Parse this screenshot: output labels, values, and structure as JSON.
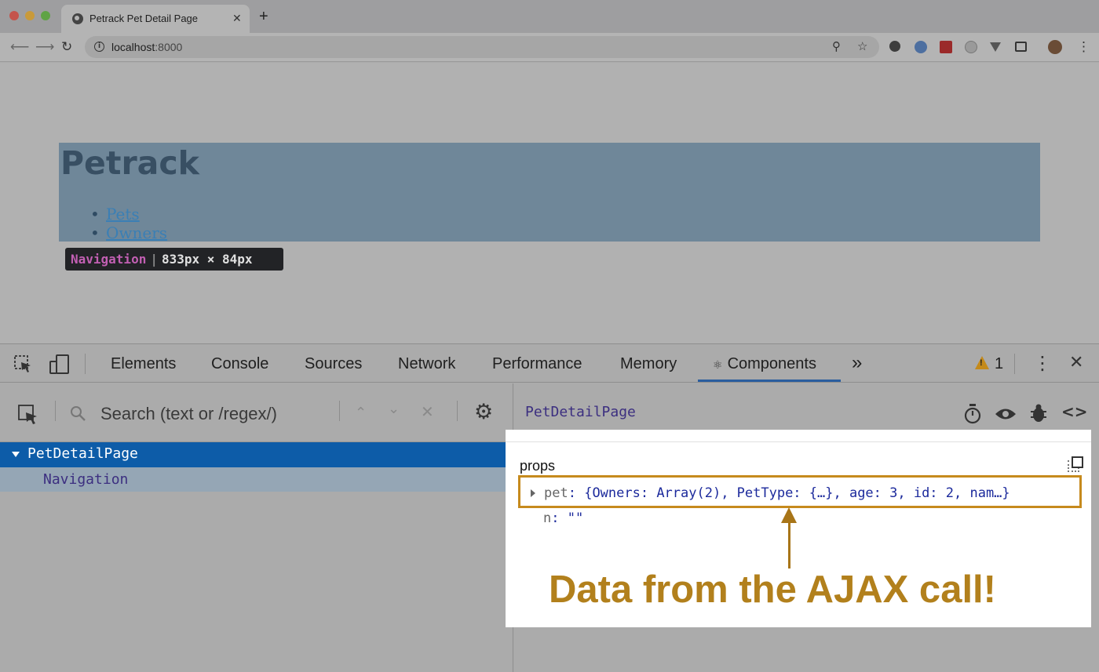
{
  "browser": {
    "tab_title": "Petrack Pet Detail Page",
    "tab_close": "✕",
    "new_tab": "+",
    "url_host": "localhost",
    "url_port": ":8000"
  },
  "page": {
    "site_title": "Petrack",
    "nav_links": [
      "Pets",
      "Owners"
    ],
    "inspect_tooltip": {
      "component": "Navigation",
      "separator": "|",
      "size": "833px × 84px"
    }
  },
  "devtools": {
    "tabs": [
      "Elements",
      "Console",
      "Sources",
      "Network",
      "Performance",
      "Memory",
      "Components"
    ],
    "active_tab": "Components",
    "more_tabs": "»",
    "warning_count": "1",
    "close": "✕",
    "search_placeholder": "Search (text or /regex/)",
    "tree": [
      {
        "label": "PetDetailPage",
        "selected": true
      },
      {
        "label": "Navigation",
        "selected": false
      }
    ],
    "selected_component": "PetDetailPage",
    "props_title": "props",
    "props": {
      "pet_key": "pet",
      "pet_value": "{Owners: Array(2), PetType: {…}, age: 3, id: 2, nam…}",
      "n_key": "n",
      "n_value": "\"\""
    },
    "annotation": "Data from the AJAX call!"
  },
  "colors": {
    "selection_blue": "#0d5ca8",
    "annotation_gold": "#b2801c",
    "component_purple": "#3c2f80",
    "value_blue": "#1c2a9c"
  },
  "icons": [
    "globe-icon",
    "back-icon",
    "forward-icon",
    "reload-icon",
    "info-icon",
    "zoom-icon",
    "star-icon",
    "inspect-icon",
    "device-icon",
    "react-icon",
    "warning-icon",
    "kebab-icon",
    "search-icon",
    "chevron-up-icon",
    "chevron-down-icon",
    "clear-icon",
    "gear-icon",
    "timer-icon",
    "eye-icon",
    "bug-icon",
    "code-icon",
    "copy-icon"
  ]
}
